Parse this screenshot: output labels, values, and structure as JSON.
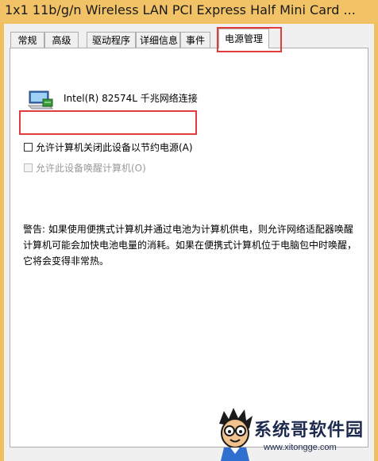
{
  "window": {
    "title": "1x1 11b/g/n Wireless LAN PCI Express Half Mini Card ..."
  },
  "tabs": [
    {
      "label": "常规"
    },
    {
      "label": "高级"
    },
    {
      "label": "驱动程序"
    },
    {
      "label": "详细信息"
    },
    {
      "label": "事件"
    },
    {
      "label": "电源管理",
      "active": true
    }
  ],
  "device": {
    "icon": "network-adapter-icon",
    "name": "Intel(R) 82574L 千兆网络连接"
  },
  "power_options": [
    {
      "label": "允许计算机关闭此设备以节约电源(A)",
      "checked": false,
      "enabled": true
    },
    {
      "label": "允许此设备唤醒计算机(O)",
      "checked": false,
      "enabled": false
    }
  ],
  "warning": "警告: 如果使用便携式计算机并通过电池为计算机供电，则允许网络适配器唤醒计算机可能会加快电池电量的消耗。如果在便携式计算机位于电脑包中时唤醒，它将会变得非常热。",
  "highlight_color": "#e23b3b",
  "watermark": {
    "name": "系统哥软件园",
    "url": "www.xitongge.com"
  }
}
